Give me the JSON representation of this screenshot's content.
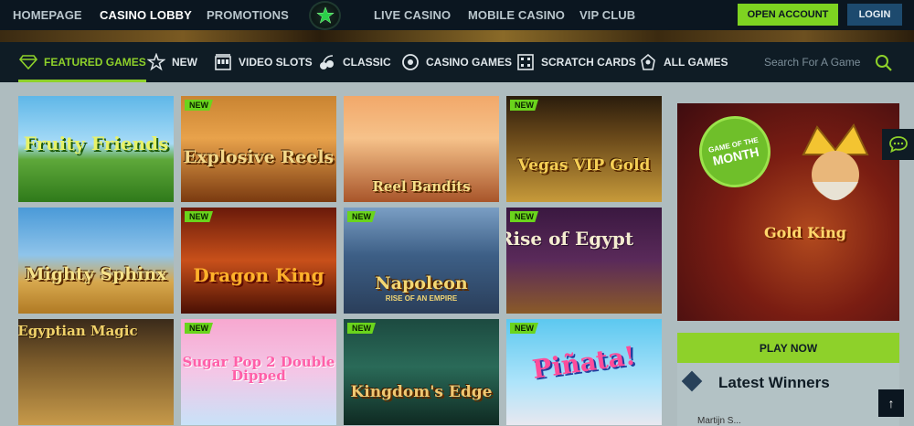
{
  "topnav": {
    "links": [
      "HOMEPAGE",
      "CASINO LOBBY",
      "PROMOTIONS",
      "LIVE CASINO",
      "MOBILE CASINO",
      "VIP CLUB"
    ],
    "active": "CASINO LOBBY",
    "open_account": "OPEN ACCOUNT",
    "login": "LOGIN"
  },
  "categories": {
    "items": [
      "FEATURED GAMES",
      "NEW",
      "VIDEO SLOTS",
      "CLASSIC",
      "CASINO GAMES",
      "SCRATCH CARDS",
      "ALL GAMES"
    ],
    "active": "FEATURED GAMES"
  },
  "search": {
    "placeholder": "Search For A Game"
  },
  "games": [
    {
      "title": "Fruity Friends",
      "new": false
    },
    {
      "title": "Explosive Reels",
      "new": true,
      "badge": "NEW"
    },
    {
      "title": "Reel Bandits",
      "new": false
    },
    {
      "title": "Vegas VIP Gold",
      "new": true,
      "badge": "NEW"
    },
    {
      "title": "Mighty Sphinx",
      "new": false
    },
    {
      "title": "Dragon King",
      "new": true,
      "badge": "NEW"
    },
    {
      "title": "Napoleon",
      "subtitle": "RISE OF AN EMPIRE",
      "new": true,
      "badge": "NEW"
    },
    {
      "title": "Rise of Egypt",
      "new": true,
      "badge": "NEW"
    },
    {
      "title": "Egyptian Magic",
      "new": false
    },
    {
      "title": "Sugar Pop 2 Double Dipped",
      "new": true,
      "badge": "NEW"
    },
    {
      "title": "Kingdom's Edge",
      "new": true,
      "badge": "NEW"
    },
    {
      "title": "Piñata!",
      "new": true,
      "badge": "NEW"
    }
  ],
  "promo": {
    "badge_top": "GAME OF THE",
    "badge_bottom": "MONTH",
    "game": "Gold King",
    "play": "PLAY NOW"
  },
  "winners": {
    "title": "Latest Winners",
    "first_name": "Martijn S..."
  },
  "icons": {
    "chat": "chat-bubble-icon",
    "back_to_top": "arrow-up-icon",
    "search": "search-icon"
  },
  "colors": {
    "accent": "#8ed12a",
    "nav_bg": "#0b1620",
    "cat_bg": "#0f1c25"
  }
}
